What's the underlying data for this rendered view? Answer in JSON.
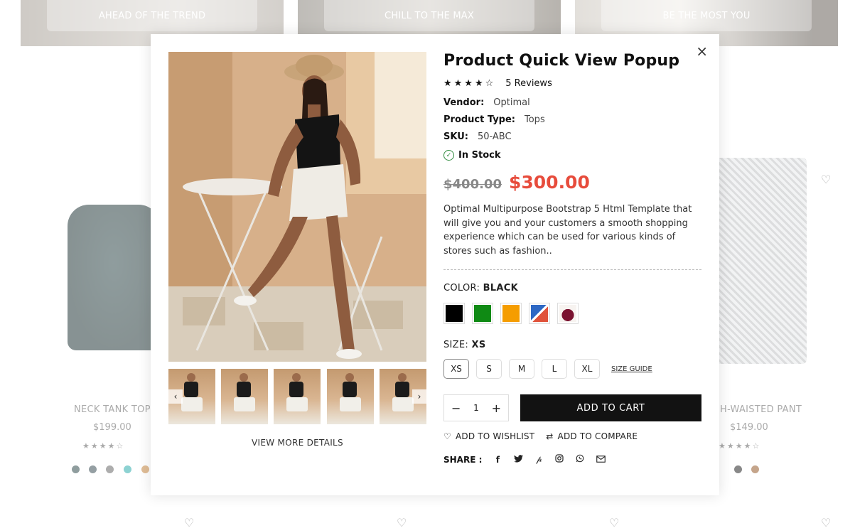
{
  "background": {
    "banners": [
      "AHEAD OF THE TREND",
      "CHILL TO THE MAX",
      "BE THE MOST YOU"
    ],
    "products": [
      {
        "title": "NECK TANK TOP",
        "price": "$199.00",
        "stars": "★★★★☆"
      },
      {
        "title": "H-WAISTED PANT",
        "price": "$149.00",
        "stars": "★★★★☆"
      }
    ],
    "left_dots": [
      "#1f3a3c",
      "#2b3f46",
      "#5b5b5b",
      "#1aa5a5",
      "#c07a2c"
    ],
    "right_dots": [
      "#111111",
      "#8a4b17"
    ]
  },
  "modal": {
    "close_label": "×",
    "title": "Product Quick View Popup",
    "stars": "★★★★☆",
    "reviews": "5 Reviews",
    "vendor": {
      "label": "Vendor:",
      "value": "Optimal"
    },
    "product_type": {
      "label": "Product Type:",
      "value": "Tops"
    },
    "sku": {
      "label": "SKU:",
      "value": "50-ABC"
    },
    "stock": "In Stock",
    "old_price": "$400.00",
    "new_price": "$300.00",
    "description": "Optimal Multipurpose Bootstrap 5 Html Template that will give you and your customers a smooth shopping experience which can be used for various kinds of stores such as fashion..",
    "color": {
      "label": "COLOR:",
      "value": "BLACK",
      "swatches": [
        "#000000",
        "#0f8a14",
        "#f59d00",
        "#2d68c4",
        "#7a1230"
      ]
    },
    "size": {
      "label": "SIZE:",
      "value": "XS",
      "options": [
        "XS",
        "S",
        "M",
        "L",
        "XL"
      ],
      "guide": "SIZE GUIDE"
    },
    "quantity": "1",
    "add_to_cart": "ADD TO CART",
    "add_to_wishlist": "ADD TO WISHLIST",
    "add_to_compare": "ADD TO COMPARE",
    "share_label": "SHARE :",
    "view_more": "VIEW MORE DETAILS",
    "prev": "‹",
    "next": "›"
  }
}
